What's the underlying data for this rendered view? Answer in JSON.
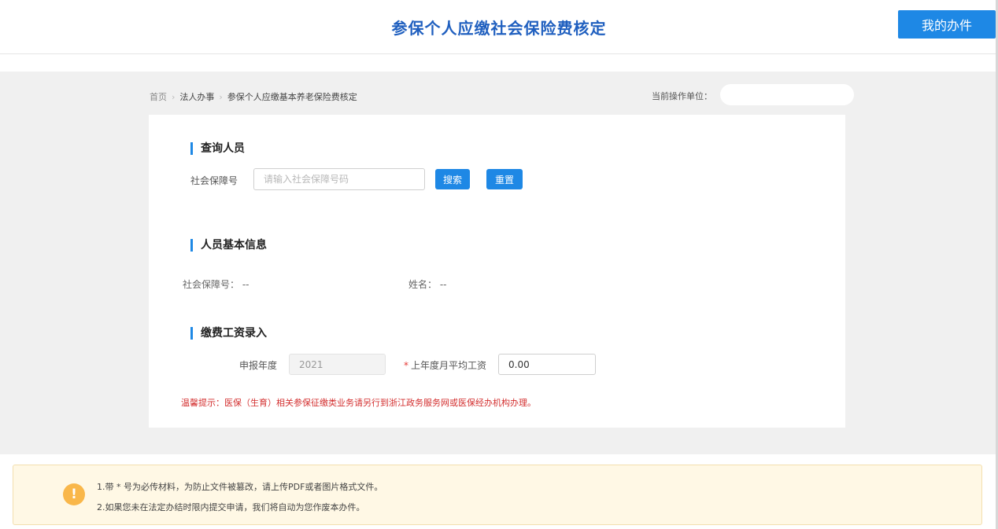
{
  "header": {
    "title": "参保个人应缴社会保险费核定",
    "my_tasks_label": "我的办件"
  },
  "breadcrumb": {
    "items": [
      "首页",
      "法人办事",
      "参保个人应缴基本养老保险费核定"
    ],
    "separator": "›"
  },
  "operating_unit": {
    "label": "当前操作单位："
  },
  "query": {
    "title": "查询人员",
    "ssn_label": "社会保障号",
    "ssn_placeholder": "请输入社会保障号码",
    "ssn_value": "",
    "search_label": "搜索",
    "reset_label": "重置"
  },
  "basic_info": {
    "title": "人员基本信息",
    "ssn_label": "社会保障号：",
    "ssn_value": "--",
    "name_label": "姓名：",
    "name_value": "--"
  },
  "wage": {
    "title": "缴费工资录入",
    "year_label": "申报年度",
    "year_value": "2021",
    "required_mark": "*",
    "avg_wage_label": "上年度月平均工资",
    "avg_wage_value": "0.00",
    "warning": "温馨提示：医保（生育）相关参保征缴类业务请另行到浙江政务服务网或医保经办机构办理。"
  },
  "notice": {
    "icon": "!",
    "lines": [
      "1.带 * 号为必传材料，为防止文件被篡改，请上传PDF或者图片格式文件。",
      "2.如果您未在法定办结时限内提交申请，我们将自动为您作废本办件。"
    ]
  },
  "colors": {
    "accent": "#1e88e5",
    "title": "#1f5fbf",
    "warning": "#d32f2f",
    "notice_bg": "#fff8e5",
    "notice_icon": "#f9b74a"
  }
}
